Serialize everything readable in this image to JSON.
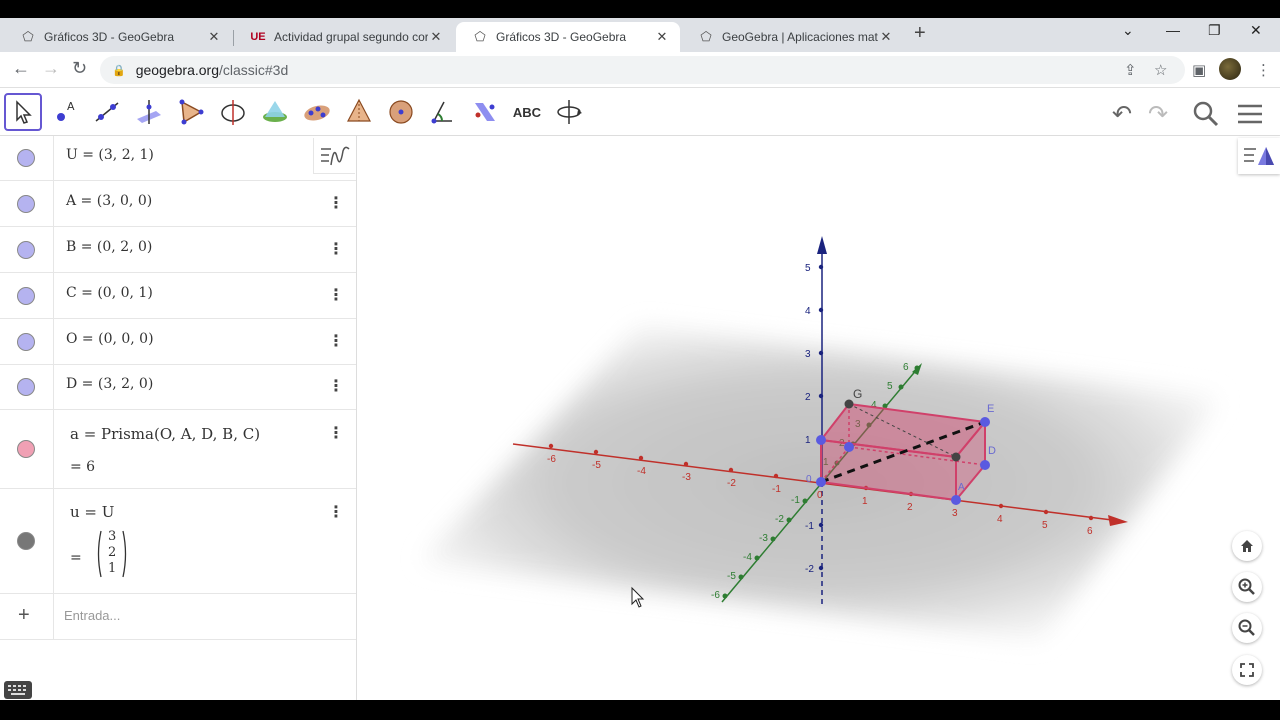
{
  "browser": {
    "tabs": [
      {
        "title": "Gráficos 3D - GeoGebra",
        "icon": "geogebra-icon",
        "active": false
      },
      {
        "title": "Actividad grupal segundo corte",
        "icon": "ue-icon",
        "active": false
      },
      {
        "title": "Gráficos 3D - GeoGebra",
        "icon": "geogebra-icon",
        "active": true
      },
      {
        "title": "GeoGebra | Aplicaciones matemá",
        "icon": "geogebra-icon",
        "active": false
      }
    ],
    "url_host": "geogebra.org",
    "url_path": "/classic#3d"
  },
  "toolbar": {
    "text_tool_label": "ABC"
  },
  "algebra": {
    "rows": [
      {
        "expr": "U = (3, 2, 1)",
        "color": "#b5b3f0"
      },
      {
        "expr": "A = (3, 0, 0)",
        "color": "#b5b3f0"
      },
      {
        "expr": "B = (0, 2, 0)",
        "color": "#b5b3f0"
      },
      {
        "expr": "C = (0, 0, 1)",
        "color": "#b5b3f0"
      },
      {
        "expr": "O = (0, 0, 0)",
        "color": "#b5b3f0"
      },
      {
        "expr": "D = (3, 2, 0)",
        "color": "#b5b3f0"
      },
      {
        "expr": "a = Prisma(O, A, D, B, C)",
        "value": "= 6",
        "color": "#f0a0b4"
      },
      {
        "expr": "u = U",
        "value_prefix": "=",
        "vector": [
          "3",
          "2",
          "1"
        ],
        "color": "#777777"
      }
    ],
    "input_placeholder": "Entrada..."
  },
  "view3d": {
    "x_ticks": [
      "-6",
      "-5",
      "-4",
      "-3",
      "-2",
      "-1",
      "0",
      "1",
      "2",
      "3",
      "4",
      "5",
      "6"
    ],
    "y_ticks": [
      "-6",
      "-5",
      "-4",
      "-3",
      "-2",
      "-1",
      "1",
      "2",
      "3",
      "4",
      "5",
      "6"
    ],
    "z_ticks": [
      "-2",
      "-1",
      "1",
      "2",
      "3",
      "4",
      "5"
    ],
    "point_labels": [
      "G",
      "E",
      "D",
      "A",
      "0"
    ],
    "axis_colors": {
      "x": "#c0302a",
      "y": "#2e7d32",
      "z": "#1a237e"
    },
    "prism_color": "#d0406a"
  }
}
